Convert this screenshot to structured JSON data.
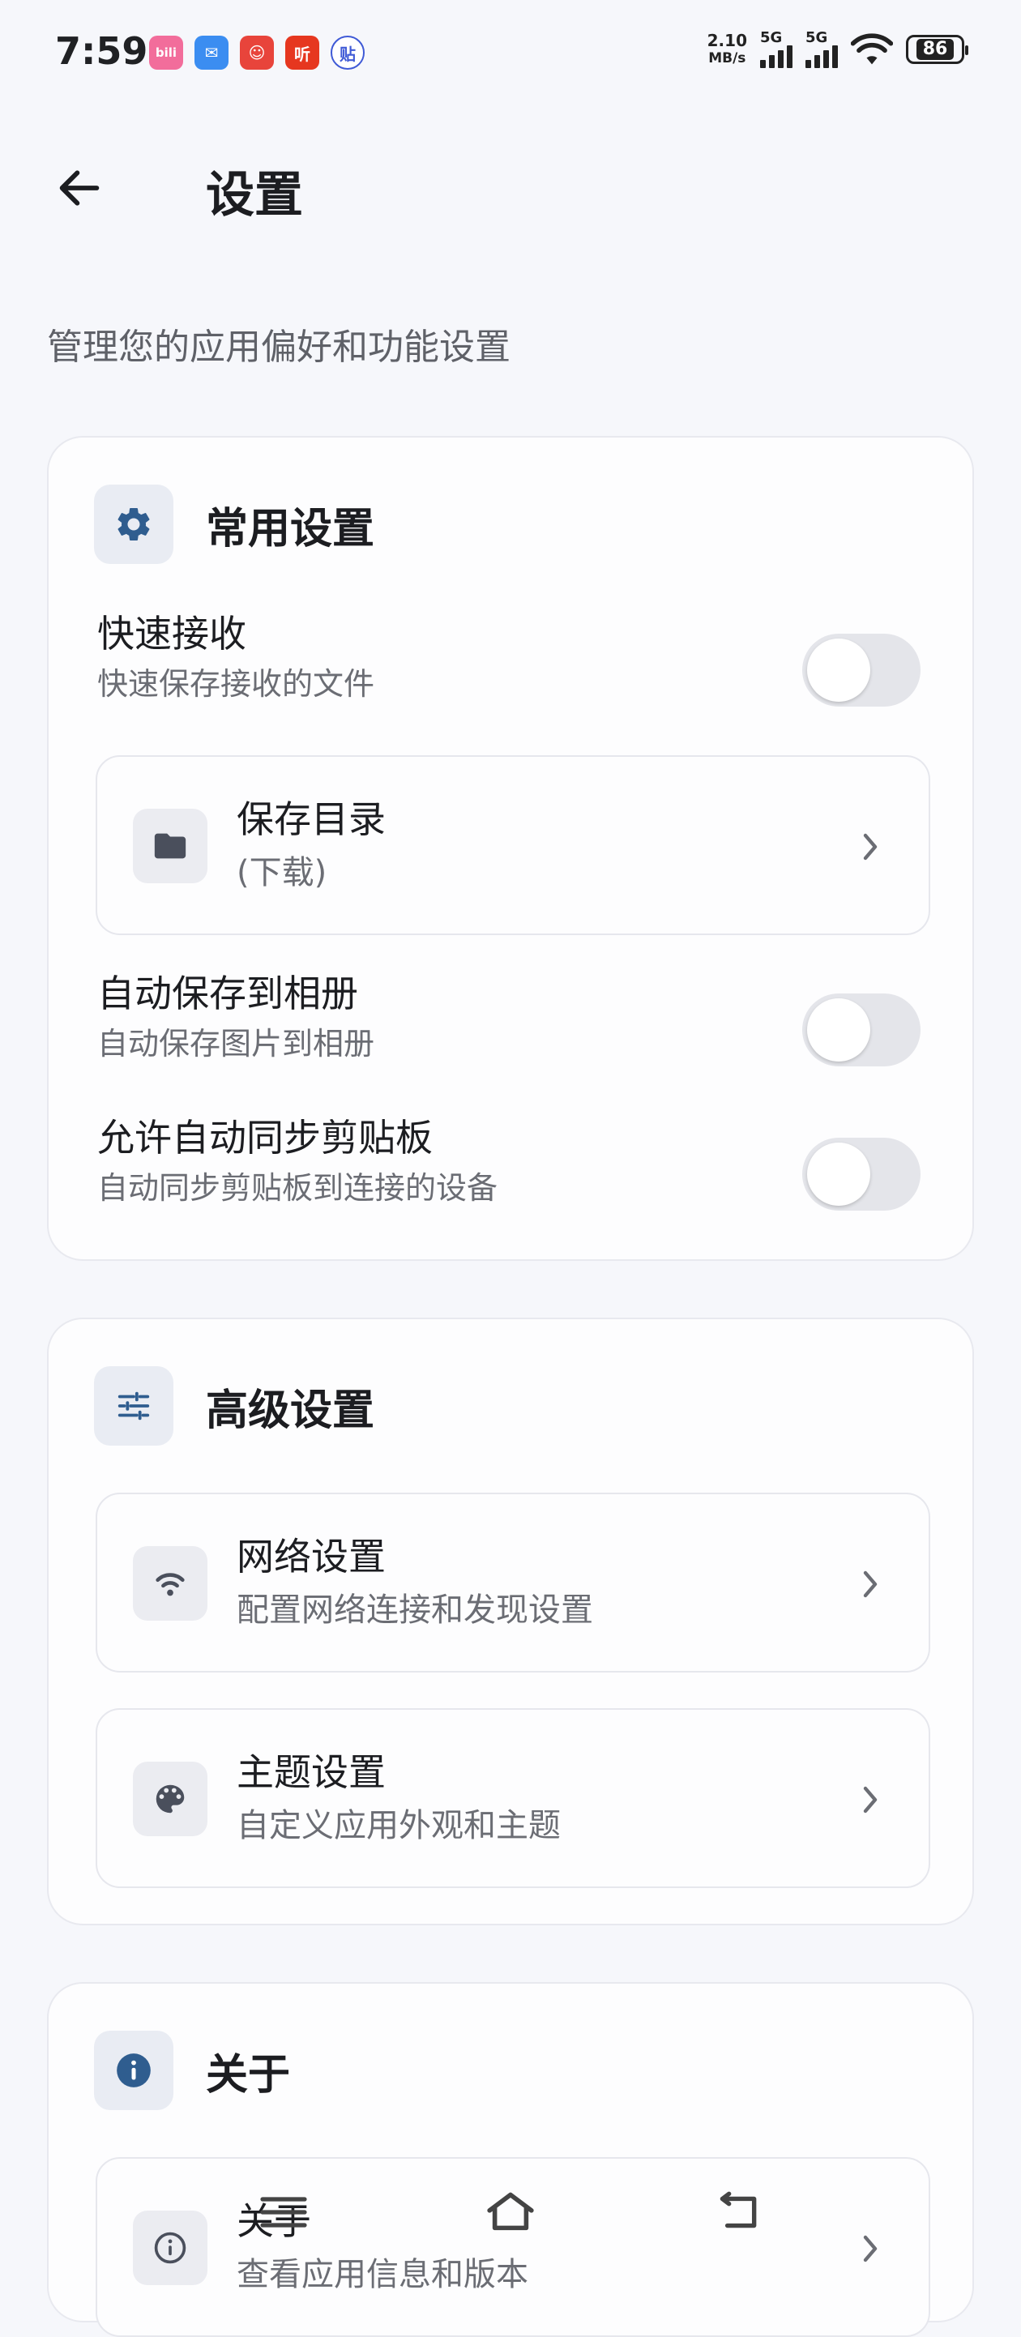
{
  "status_bar": {
    "time": "7:59",
    "apps": [
      {
        "icon": "bilibili-icon",
        "label": "bili",
        "color": "#f26d9b"
      },
      {
        "icon": "mail-icon",
        "label": "✉",
        "color": "#3b8df1"
      },
      {
        "icon": "game-icon",
        "label": "☺",
        "color": "#e8443b"
      },
      {
        "icon": "listen-icon",
        "label": "听",
        "color": "#e6371f"
      },
      {
        "icon": "tieba-icon",
        "label": "贴",
        "color": "#3f5ad6"
      }
    ],
    "net_speed_value": "2.10",
    "net_speed_unit": "MB/s",
    "sim1": "5G",
    "sim2": "5G",
    "battery": "86"
  },
  "header": {
    "title": "设置",
    "subtitle": "管理您的应用偏好和功能设置"
  },
  "common": {
    "title": "常用设置",
    "icon": "gear-icon",
    "quick_receive": {
      "title": "快速接收",
      "desc": "快速保存接收的文件",
      "enabled": false
    },
    "save_dir": {
      "title": "保存目录",
      "desc": "(下载)",
      "icon": "folder-icon"
    },
    "auto_save_album": {
      "title": "自动保存到相册",
      "desc": "自动保存图片到相册",
      "enabled": false
    },
    "clipboard_sync": {
      "title": "允许自动同步剪贴板",
      "desc": "自动同步剪贴板到连接的设备",
      "enabled": false
    }
  },
  "advanced": {
    "title": "高级设置",
    "icon": "sliders-icon",
    "network": {
      "title": "网络设置",
      "desc": "配置网络连接和发现设置",
      "icon": "wifi-icon"
    },
    "theme": {
      "title": "主题设置",
      "desc": "自定义应用外观和主题",
      "icon": "palette-icon"
    }
  },
  "about": {
    "title": "关于",
    "icon": "info-filled-icon",
    "app_info": {
      "title": "关于",
      "desc": "查看应用信息和版本",
      "icon": "info-outline-icon"
    }
  },
  "colors": {
    "accent": "#2f5d8f",
    "background": "#f6f7fb",
    "card": "#fdfdfe",
    "toggle_off": "#e4e5ea"
  }
}
